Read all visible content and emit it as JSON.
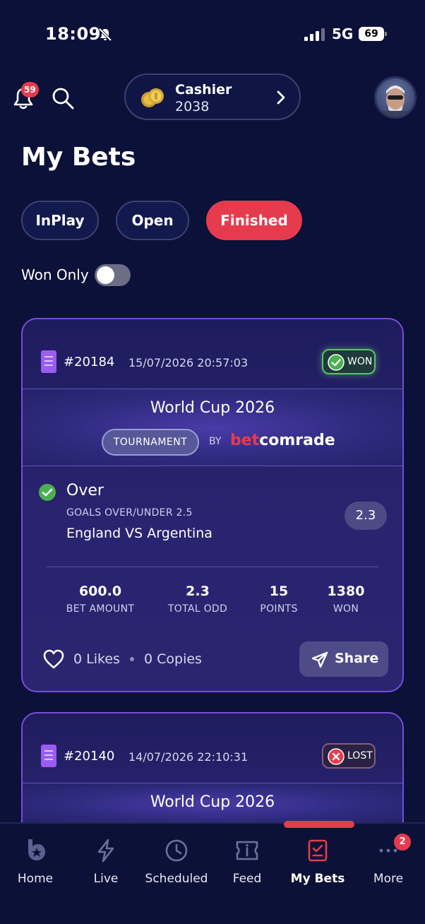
{
  "status_bar": {
    "time": "18:09",
    "network": "5G",
    "battery": "69"
  },
  "header": {
    "notification_count": "59",
    "cashier": {
      "label": "Cashier",
      "amount": "2038"
    }
  },
  "page_title": "My Bets",
  "tabs": [
    {
      "label": "InPlay",
      "active": false
    },
    {
      "label": "Open",
      "active": false
    },
    {
      "label": "Finished",
      "active": true
    }
  ],
  "filter": {
    "won_only_label": "Won Only",
    "won_only_enabled": false
  },
  "bets": [
    {
      "id": "#20184",
      "date": "15/07/2026 20:57:03",
      "status": "WON",
      "event": "World Cup 2026",
      "tag": "TOURNAMENT",
      "by": "BY",
      "brand_bet": "bet",
      "brand_comrade": "comrade",
      "pick": "Over",
      "market": "GOALS OVER/UNDER 2.5",
      "match": "England VS Argentina",
      "odd": "2.3",
      "stats": [
        {
          "value": "600.0",
          "label": "BET AMOUNT"
        },
        {
          "value": "2.3",
          "label": "TOTAL ODD"
        },
        {
          "value": "15",
          "label": "POINTS"
        },
        {
          "value": "1380",
          "label": "WON"
        }
      ],
      "likes": "0 Likes",
      "copies": "0 Copies",
      "share_label": "Share"
    },
    {
      "id": "#20140",
      "date": "14/07/2026 22:10:31",
      "status": "LOST",
      "event": "World Cup 2026"
    }
  ],
  "bottom_nav": {
    "items": [
      {
        "label": "Home",
        "icon": "home-icon"
      },
      {
        "label": "Live",
        "icon": "lightning-icon"
      },
      {
        "label": "Scheduled",
        "icon": "clock-icon"
      },
      {
        "label": "Feed",
        "icon": "feed-icon"
      },
      {
        "label": "My Bets",
        "icon": "bets-icon",
        "active": true
      },
      {
        "label": "More",
        "icon": "more-icon"
      }
    ],
    "more_badge": "2"
  },
  "colors": {
    "background": "#0b1139",
    "accent": "#e63b4d",
    "won": "#4caf50",
    "card_border": "#7a4cd8"
  }
}
